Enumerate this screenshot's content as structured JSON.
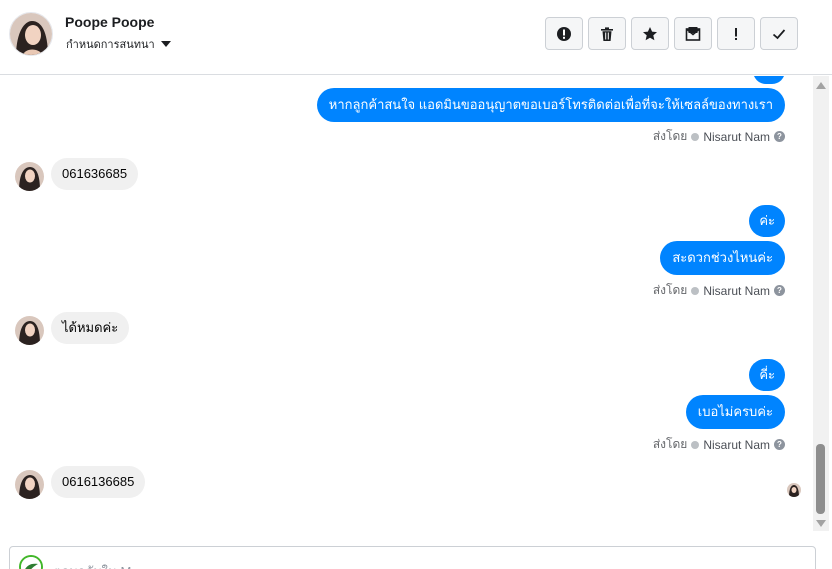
{
  "header": {
    "contact_name": "Poope Poope",
    "subtitle": "กำหนดการสนทนา",
    "toolbar": [
      {
        "name": "spam-alert",
        "icon": "exclamation-circle-icon"
      },
      {
        "name": "delete",
        "icon": "trash-icon"
      },
      {
        "name": "star",
        "icon": "star-icon"
      },
      {
        "name": "mark-unread",
        "icon": "envelope-icon"
      },
      {
        "name": "follow-up",
        "icon": "exclamation-icon"
      },
      {
        "name": "mark-done",
        "icon": "check-icon"
      }
    ]
  },
  "messages": [
    {
      "dir": "out",
      "text": "หากลูกค้าสนใจ แอดมินขออนุญาตขอเบอร์โทรติดต่อเพื่อที่จะให้เซลล์ของทางเรา"
    },
    {
      "dir": "meta",
      "prefix": "ส่งโดย",
      "agent": "Nisarut Nam"
    },
    {
      "dir": "in",
      "text": "061636685"
    },
    {
      "dir": "out",
      "text": "ค่ะ"
    },
    {
      "dir": "out",
      "text": "สะดวกช่วงไหนค่ะ"
    },
    {
      "dir": "meta",
      "prefix": "ส่งโดย",
      "agent": "Nisarut Nam"
    },
    {
      "dir": "in",
      "text": "ได้หมดค่ะ"
    },
    {
      "dir": "out",
      "text": "คี่ะ"
    },
    {
      "dir": "out",
      "text": "เบอไม่ครบค่ะ"
    },
    {
      "dir": "meta",
      "prefix": "ส่งโดย",
      "agent": "Nisarut Nam"
    },
    {
      "dir": "in",
      "text": "0616136685"
    }
  ],
  "reply": {
    "placeholder": "ตอบกลับใน Messenger"
  },
  "colors": {
    "outgoing_bubble": "#0084ff",
    "incoming_bubble": "#f0f0f0",
    "meta_text": "#65676b"
  }
}
